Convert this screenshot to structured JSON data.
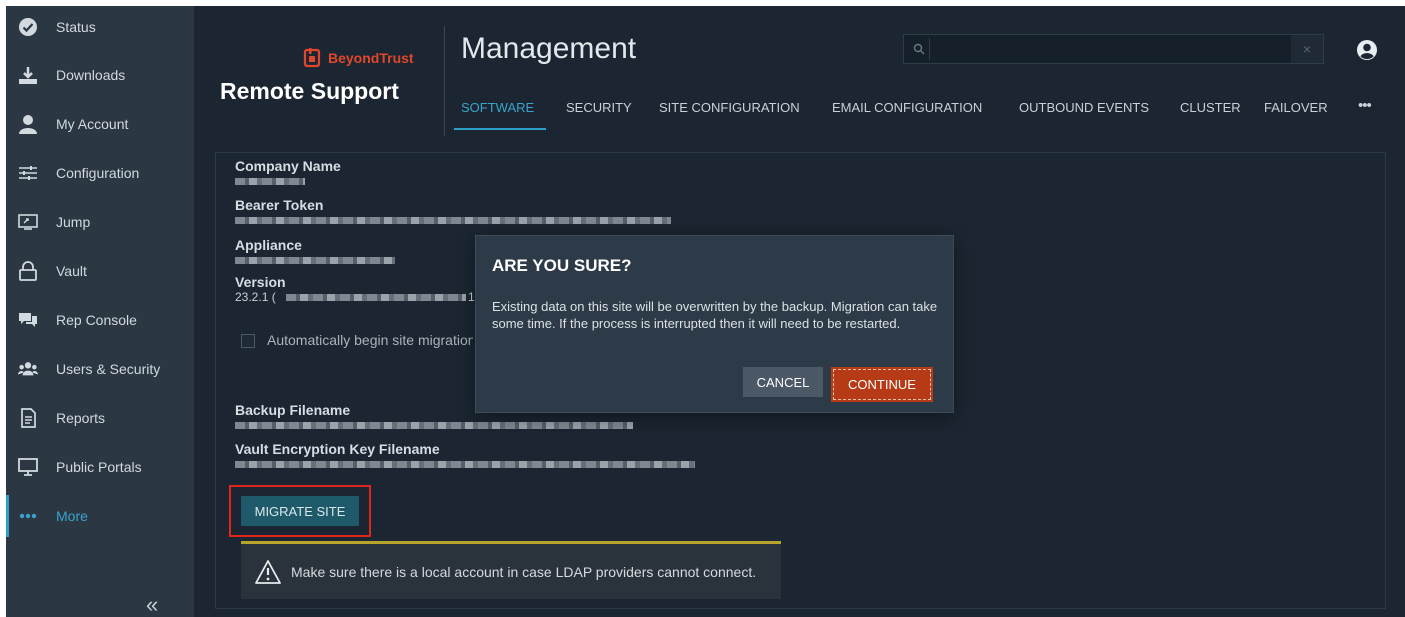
{
  "sidebar": {
    "items": [
      {
        "label": "Status",
        "icon": "check-circle-icon"
      },
      {
        "label": "Downloads",
        "icon": "download-icon"
      },
      {
        "label": "My Account",
        "icon": "user-icon"
      },
      {
        "label": "Configuration",
        "icon": "sliders-icon"
      },
      {
        "label": "Jump",
        "icon": "jump-icon"
      },
      {
        "label": "Vault",
        "icon": "lock-icon"
      },
      {
        "label": "Rep Console",
        "icon": "chat-icon"
      },
      {
        "label": "Users & Security",
        "icon": "users-icon"
      },
      {
        "label": "Reports",
        "icon": "report-icon"
      },
      {
        "label": "Public Portals",
        "icon": "monitor-icon"
      },
      {
        "label": "More",
        "icon": "dots-icon",
        "active": true
      }
    ],
    "collapse_glyph": "«"
  },
  "header": {
    "brand_logo_text": "BeyondTrust",
    "brand_title": "Remote Support",
    "page_title": "Management",
    "tabs": [
      {
        "label": "SOFTWARE",
        "active": true
      },
      {
        "label": "SECURITY"
      },
      {
        "label": "SITE CONFIGURATION"
      },
      {
        "label": "EMAIL CONFIGURATION"
      },
      {
        "label": "OUTBOUND EVENTS"
      },
      {
        "label": "CLUSTER"
      },
      {
        "label": "FAILOVER"
      },
      {
        "label": "•••"
      }
    ],
    "search": {
      "placeholder": "",
      "value": "",
      "clear_glyph": "×"
    }
  },
  "panel": {
    "company_name_label": "Company Name",
    "bearer_token_label": "Bearer Token",
    "appliance_label": "Appliance",
    "version_label": "Version",
    "version_prefix": "23.2.1 (",
    "version_suffix": "1",
    "auto_migrate_label": "Automatically begin site migration",
    "backup_filename_label": "Backup Filename",
    "vault_key_label": "Vault Encryption Key Filename",
    "migrate_button": "MIGRATE SITE",
    "alert_text": "Make sure there is a local account in case LDAP providers cannot connect."
  },
  "modal": {
    "title": "ARE YOU SURE?",
    "body": "Existing data on this site will be overwritten by the backup. Migration can take some time. If the process is interrupted then it will need to be restarted.",
    "cancel_label": "CANCEL",
    "continue_label": "CONTINUE"
  },
  "colors": {
    "accent": "#2e9fc6",
    "brand": "#e0472a",
    "continue": "#b73a16",
    "highlight_box": "#e0251b",
    "alert_warning": "#b8a42a"
  }
}
